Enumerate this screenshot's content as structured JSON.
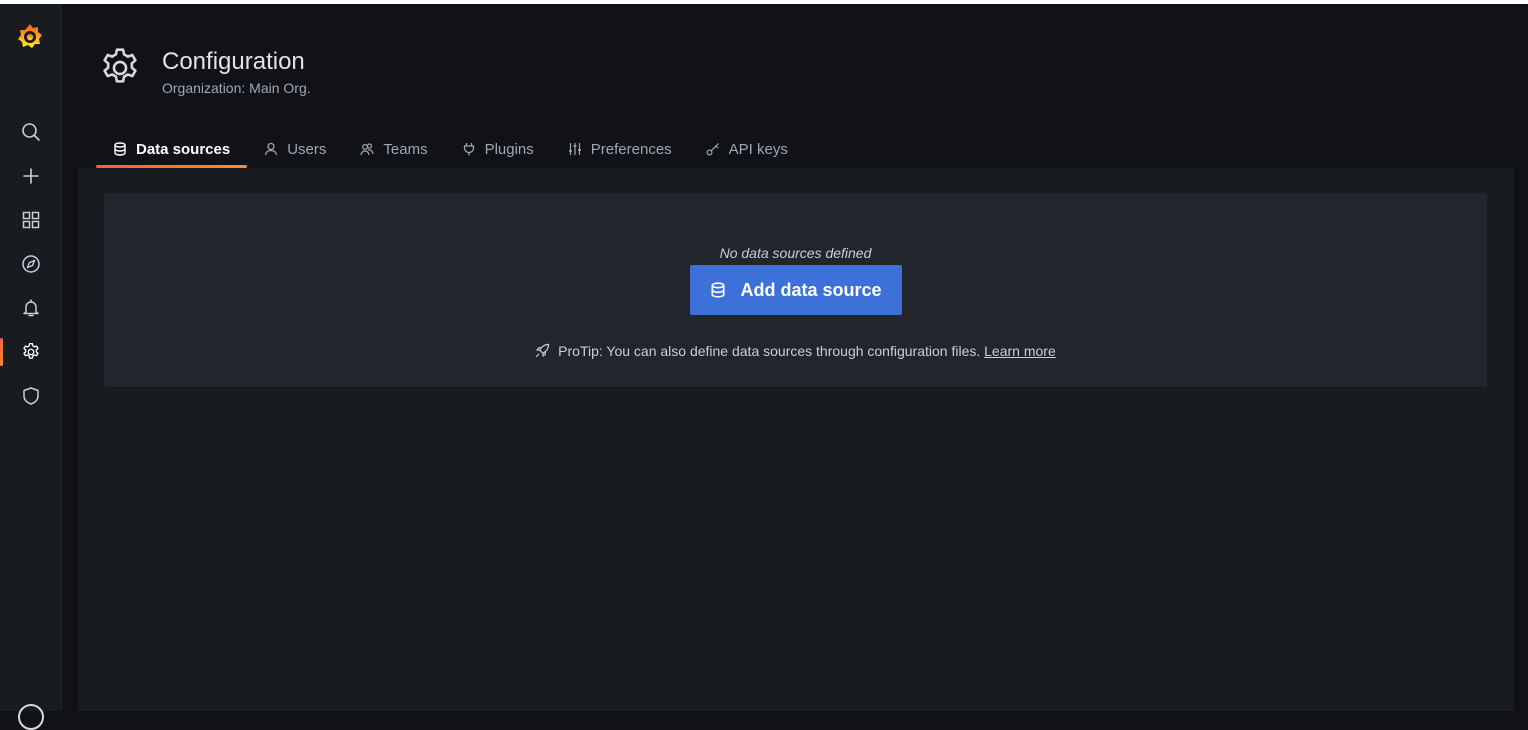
{
  "sidebar": {
    "logo_icon": "grafana-logo-icon",
    "items": [
      {
        "name": "search",
        "icon": "search-icon",
        "active": false
      },
      {
        "name": "create",
        "icon": "plus-icon",
        "active": false
      },
      {
        "name": "dashboards",
        "icon": "apps-icon",
        "active": false
      },
      {
        "name": "explore",
        "icon": "compass-icon",
        "active": false
      },
      {
        "name": "alerting",
        "icon": "bell-icon",
        "active": false
      },
      {
        "name": "configuration",
        "icon": "cog-icon",
        "active": true
      },
      {
        "name": "server-admin",
        "icon": "shield-icon",
        "active": false
      }
    ]
  },
  "header": {
    "icon": "cog-icon",
    "title": "Configuration",
    "subtitle": "Organization: Main Org."
  },
  "tabs": [
    {
      "label": "Data sources",
      "icon": "database-icon",
      "active": true
    },
    {
      "label": "Users",
      "icon": "user-icon",
      "active": false
    },
    {
      "label": "Teams",
      "icon": "users-alt-icon",
      "active": false
    },
    {
      "label": "Plugins",
      "icon": "plug-icon",
      "active": false
    },
    {
      "label": "Preferences",
      "icon": "sliders-icon",
      "active": false
    },
    {
      "label": "API keys",
      "icon": "key-icon",
      "active": false
    }
  ],
  "empty_state": {
    "title": "No data sources defined",
    "button_label": "Add data source",
    "button_icon": "database-icon",
    "protip_icon": "rocket-icon",
    "protip_text": "ProTip: You can also define data sources through configuration files.",
    "protip_link": "Learn more"
  },
  "colors": {
    "background": "#111217",
    "panel": "#181b1f",
    "box": "#22252b",
    "primary": "#3d71d9",
    "accent_start": "#f55f3e",
    "accent_end": "#ff8833"
  }
}
